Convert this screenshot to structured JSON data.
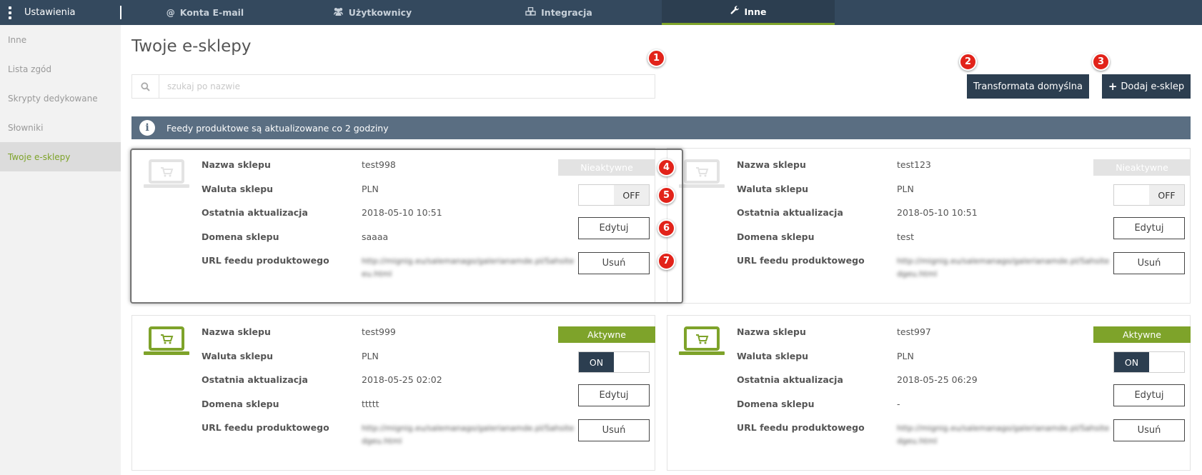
{
  "topbar": {
    "brand": "Ustawienia",
    "tabs": [
      {
        "label": "Konta E-mail",
        "icon": "at-icon"
      },
      {
        "label": "Użytkownicy",
        "icon": "users-icon"
      },
      {
        "label": "Integracja",
        "icon": "cubes-icon"
      },
      {
        "label": "Inne",
        "icon": "wrench-icon"
      }
    ]
  },
  "sidebar": {
    "items": [
      {
        "label": "Inne"
      },
      {
        "label": "Lista zgód"
      },
      {
        "label": "Skrypty dedykowane"
      },
      {
        "label": "Słowniki"
      },
      {
        "label": "Twoje e-sklepy"
      }
    ]
  },
  "main": {
    "title": "Twoje e-sklepy",
    "search_placeholder": "szukaj po nazwie",
    "transform_button": "Transformata domyślna",
    "add_button": "Dodaj e-sklep",
    "info_text": "Feedy produktowe są aktualizowane co 2 godziny"
  },
  "field_labels": {
    "name": "Nazwa sklepu",
    "currency": "Waluta sklepu",
    "updated": "Ostatnia aktualizacja",
    "domain": "Domena sklepu",
    "feed_url": "URL feedu produktowego"
  },
  "buttons": {
    "edit": "Edytuj",
    "delete": "Usuń",
    "toggle_on": "ON",
    "toggle_off": "OFF"
  },
  "shops": [
    {
      "name": "test998",
      "currency": "PLN",
      "updated": "2018-05-10 10:51",
      "domain": "saaaa",
      "feed_url": "http://mignig.eu/salemanago/galerianamde.pl/Sahsiteeu.html",
      "status": "Nieaktywne",
      "active": false
    },
    {
      "name": "test123",
      "currency": "PLN",
      "updated": "2018-05-10 10:51",
      "domain": "test",
      "feed_url": "http://mignig.eu/salemanago/galerianamde.pl/Sahsitedgeu.html",
      "status": "Nieaktywne",
      "active": false
    },
    {
      "name": "test999",
      "currency": "PLN",
      "updated": "2018-05-25 02:02",
      "domain": "ttttt",
      "feed_url": "http://mignig.eu/salemanago/galerianamde.pl/Sahsitedgeu.html",
      "status": "Aktywne",
      "active": true
    },
    {
      "name": "test997",
      "currency": "PLN",
      "updated": "2018-05-25 06:29",
      "domain": "-",
      "feed_url": "http://mignig.eu/salemanago/galerianamde.pl/Sahsitedgeu.html",
      "status": "Aktywne",
      "active": true
    }
  ],
  "badges": [
    "1",
    "2",
    "3",
    "4",
    "5",
    "6",
    "7"
  ],
  "colors": {
    "navy": "#2c3e50",
    "green": "#7ea32a",
    "info": "#5a6e82",
    "badge": "#e2231a"
  }
}
